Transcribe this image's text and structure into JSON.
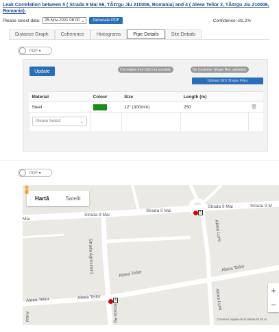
{
  "header": {
    "title": "Leak Correlation between 5 ( Strada 9 Mai 66, TÃ¢rgu Jiu 210006, Romania) and 4 ( Aleea Teilor 3, TÃ¢rgu Jiu 210006, Romania).",
    "date_label": "Please select date:",
    "date_value": "25-Nov-2021 06:00",
    "generate_pdf_label": "Generate PDF",
    "confidence": "Confidence:-81.2%"
  },
  "tabs": [
    {
      "label": "Distance Graph"
    },
    {
      "label": "Coherence"
    },
    {
      "label": "Histograms"
    },
    {
      "label": "Pipe Details",
      "active": true
    },
    {
      "label": "Site Details"
    }
  ],
  "pdf_toggle": {
    "label": "PDF"
  },
  "pipe_panel": {
    "update_label": "Update",
    "badge_gis": "Correlation from GIS not possible.",
    "badge_shape": "No Customer Shape files uploaded.",
    "upload_label": "Upload GIS Shape Files",
    "columns": [
      "Material",
      "Colour",
      "Size",
      "Length (m)"
    ],
    "rows": [
      {
        "material": "Steel",
        "colour": "#1a8c1a",
        "size": "12\" (300mm)",
        "length": "250"
      }
    ],
    "select_placeholder": "Please Select"
  },
  "map": {
    "map_tab": "Hartă",
    "satellite_tab": "Satelit",
    "streets": {
      "mai": "Mai",
      "strada9mai_1": "Strada 9 Mai",
      "strada9mai_2": "Strada 9 Mai",
      "strada9mai_3": "Strada 9 Mai",
      "strada9mai_4": "Strada 9 M",
      "agricultorii": "Strada Agricultorii",
      "lunii": "Aleea Lunii",
      "teilor_1": "Aleea Teilor",
      "teilor_2": "Aleea Teilor",
      "teilor_3": "Aleea Teilor",
      "teilor_4": "Aleea Teilor",
      "strada_ag": "Strada Ag",
      "area": "Areal"
    },
    "marker_5": "5",
    "marker_4": "4",
    "zoom_in": "+",
    "zoom_out": "−",
    "attribution": "Comenzi rapide de la tastatură   20 m"
  }
}
